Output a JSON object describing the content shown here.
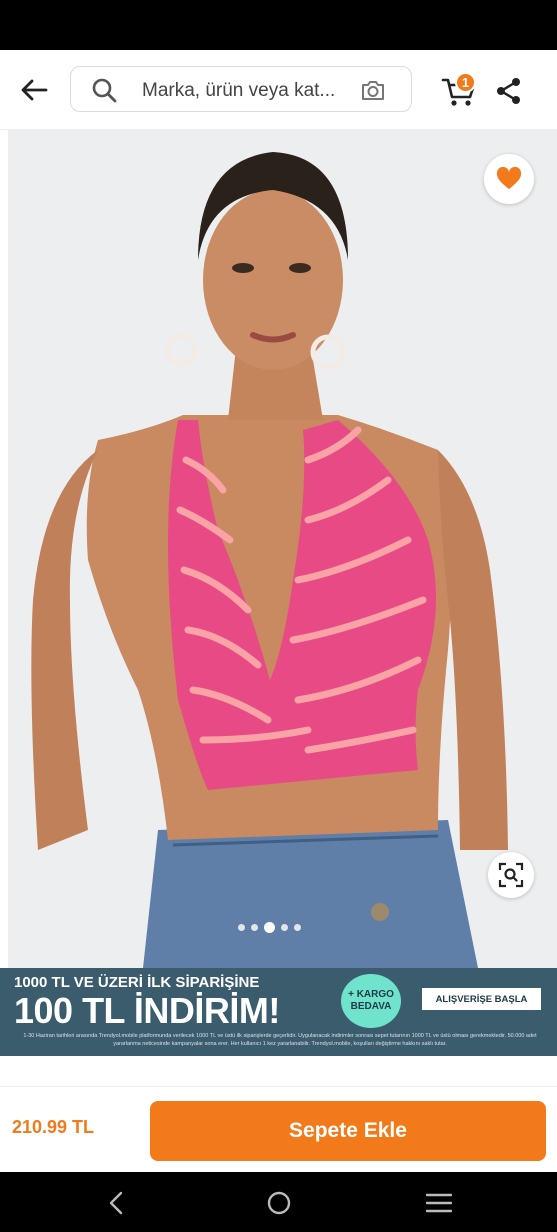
{
  "header": {
    "search_placeholder": "Marka, ürün veya kat...",
    "cart_count": "1"
  },
  "product": {
    "price": "210.99 TL",
    "add_to_cart_label": "Sepete Ekle",
    "image_count": 5,
    "active_image_index": 2,
    "favorite_color": "#f27a1a"
  },
  "promo": {
    "line1": "1000 TL VE ÜZERİ İLK SİPARİŞİNE",
    "line2": "100 TL İNDİRİM!",
    "badge_line1": "+ KARGO",
    "badge_line2": "BEDAVA",
    "cta_label": "ALIŞVERİŞE BAŞLA",
    "fine_print": "1-30 Haziran tarihleri arasında Trendyol.mobile platformunda verilecek 1000 TL ve üstü ilk siparişlerde geçerlidir. Uygulanacak indirimler sonrası sepet tutarının 1000 TL ve üstü olması gerekmektedir. 50.000 adet yararlanma neticesinde kampanyalar sona erer. Her kullanıcı 1 kez yararlanabilir. Trendyol.mobile, koşulları değiştirme hakkını saklı tutar."
  },
  "colors": {
    "accent": "#f27a1a",
    "banner_bg": "#3b5c6d",
    "badge": "#6fe3cc"
  },
  "icons": [
    "back-arrow-icon",
    "search-icon",
    "camera-icon",
    "cart-icon",
    "share-icon",
    "heart-icon",
    "visual-search-icon",
    "nav-back-icon",
    "nav-home-icon",
    "nav-menu-icon"
  ]
}
